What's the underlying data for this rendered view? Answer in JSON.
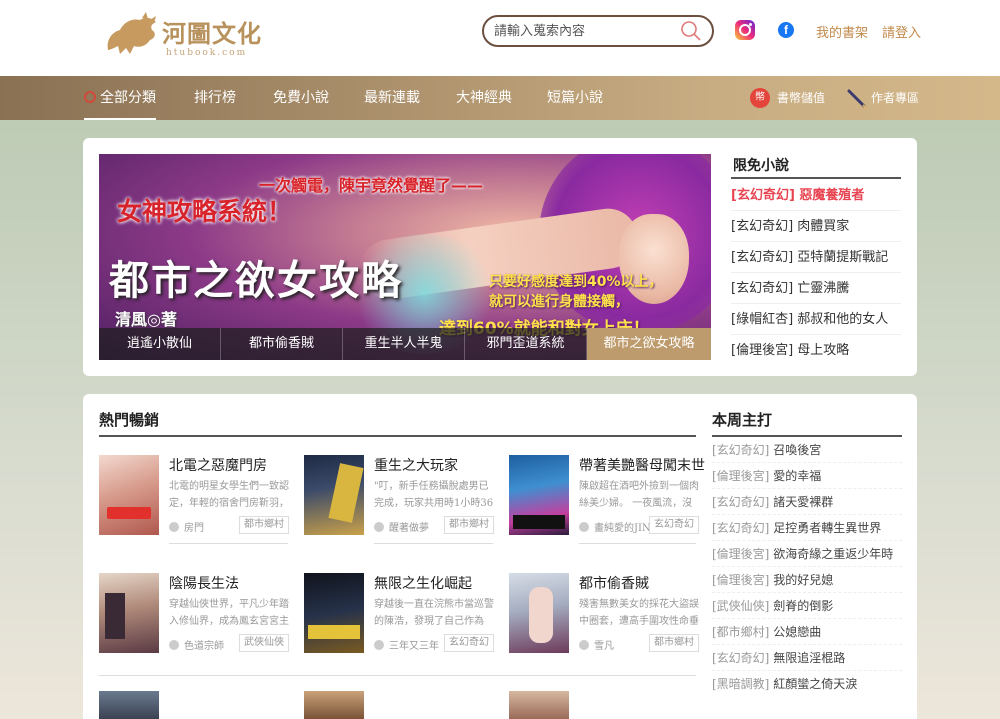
{
  "header": {
    "logo_text": "河圖文化",
    "logo_sub": "htubook.com",
    "search_placeholder": "請輸入蒐索內容",
    "links": {
      "bookshelf": "我的書架",
      "login": "請登入"
    }
  },
  "nav": {
    "items": [
      "全部分類",
      "排行榜",
      "免費小說",
      "最新連載",
      "大神經典",
      "短篇小說"
    ],
    "coins": "書幣儲值",
    "author_zone": "作者專區"
  },
  "banner": {
    "line1": "一次觸電，陳宇竟然覺醒了——",
    "line2": "女神攻略系統！",
    "title": "都市之欲女攻略",
    "promo1": "只要好感度達到40%以上，",
    "promo2": "就可以進行身體接觸，",
    "promo3": "達到60%就能和對女上床！",
    "author": "清風◎著",
    "tabs": [
      "逍遙小散仙",
      "都市偷香賊",
      "重生半人半鬼",
      "邪門歪道系統",
      "都市之欲女攻略"
    ],
    "active_tab": 4
  },
  "free_section": {
    "title": "限免小說",
    "items": [
      {
        "text": "[玄幻奇幻] 惡魔養殖者",
        "highlight": true
      },
      {
        "text": "[玄幻奇幻] 肉體買家",
        "highlight": false
      },
      {
        "text": "[玄幻奇幻] 亞特蘭提斯戰記",
        "highlight": false
      },
      {
        "text": "[玄幻奇幻] 亡靈沸騰",
        "highlight": false
      },
      {
        "text": "[綠帽紅杏] 郝叔和他的女人",
        "highlight": false
      },
      {
        "text": "[倫理後宮] 母上攻略",
        "highlight": false
      }
    ]
  },
  "hot_section": {
    "title": "熱門暢銷",
    "books": [
      {
        "title": "北電之惡魔門房",
        "desc": "北電的明星女學生們一致認定，年輕的宿舍門房靳羽，",
        "author": "房門",
        "tag": "都市鄉村"
      },
      {
        "title": "重生之大玩家",
        "desc": "\"叮，新手任務攝脫處男已完成，玩家共用時1小時36",
        "author": "醒著做夢",
        "tag": "都市鄉村"
      },
      {
        "title": "帶著美艷醫母闖末世",
        "desc": "陳啟超在酒吧外撿到一個肉絲美少婦。 一夜風流，沒",
        "author": "畫純愛的JIN",
        "tag": "玄幻奇幻"
      },
      {
        "title": "陰陽長生法",
        "desc": "穿越仙俠世界，平凡少年踏入修仙界，成為鳳玄宮宮主",
        "author": "色道宗師",
        "tag": "武俠仙俠"
      },
      {
        "title": "無限之生化崛起",
        "desc": "穿越後一直在浣熊市當巡警的陳浩，發現了自己作為NP",
        "author": "三年又三年",
        "tag": "玄幻奇幻"
      },
      {
        "title": "都市偷香賊",
        "desc": "殘害無數美女的採花大盜誤中圈套，遭高手圍攻性命垂",
        "author": "雪凡",
        "tag": "都市鄉村"
      }
    ]
  },
  "weekly_section": {
    "title": "本周主打",
    "items": [
      {
        "cat": "[玄幻奇幻]",
        "title": "召喚後宮"
      },
      {
        "cat": "[倫理後宮]",
        "title": "愛的幸福"
      },
      {
        "cat": "[玄幻奇幻]",
        "title": "諸天愛裸群"
      },
      {
        "cat": "[玄幻奇幻]",
        "title": "足控勇者轉生異世界"
      },
      {
        "cat": "[倫理後宮]",
        "title": "欲海奇緣之重返少年時"
      },
      {
        "cat": "[倫理後宮]",
        "title": "我的好兒媳"
      },
      {
        "cat": "[武俠仙俠]",
        "title": "劍脊的倒影"
      },
      {
        "cat": "[都市鄉村]",
        "title": "公媳戀曲"
      },
      {
        "cat": "[玄幻奇幻]",
        "title": "無限追淫棍路"
      },
      {
        "cat": "[黑暗調教]",
        "title": "紅顏蠻之倚天淚"
      }
    ]
  },
  "colors": {
    "accent": "#c28a4c",
    "nav_start": "#8a7154",
    "nav_end": "#d4b88a",
    "highlight": "#e84552"
  }
}
